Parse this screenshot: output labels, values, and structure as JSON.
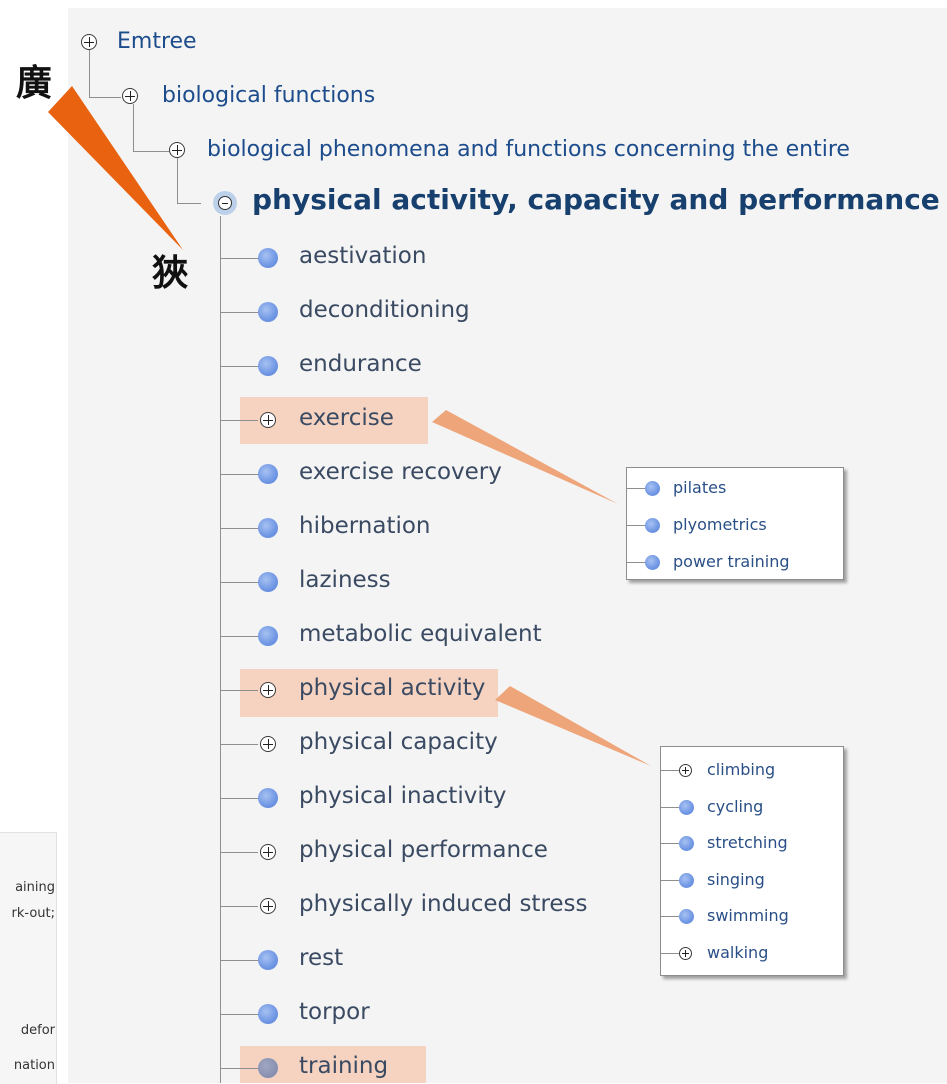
{
  "tree": {
    "root": "Emtree",
    "level1": "biological functions",
    "level2": "biological phenomena and functions concerning the entire",
    "current": "physical activity, capacity and performance",
    "children": [
      {
        "label": "aestivation",
        "type": "leaf"
      },
      {
        "label": "deconditioning",
        "type": "leaf"
      },
      {
        "label": "endurance",
        "type": "leaf"
      },
      {
        "label": "exercise",
        "type": "expand",
        "highlight": true
      },
      {
        "label": "exercise recovery",
        "type": "leaf"
      },
      {
        "label": "hibernation",
        "type": "leaf"
      },
      {
        "label": "laziness",
        "type": "leaf"
      },
      {
        "label": "metabolic equivalent",
        "type": "leaf"
      },
      {
        "label": "physical activity",
        "type": "expand",
        "highlight": true
      },
      {
        "label": "physical capacity",
        "type": "expand"
      },
      {
        "label": "physical inactivity",
        "type": "leaf"
      },
      {
        "label": "physical performance",
        "type": "expand"
      },
      {
        "label": "physically induced stress",
        "type": "expand"
      },
      {
        "label": "rest",
        "type": "leaf"
      },
      {
        "label": "torpor",
        "type": "leaf"
      },
      {
        "label": "training",
        "type": "leaf",
        "highlight": true,
        "selected": true
      }
    ]
  },
  "popups": {
    "exercise": [
      {
        "label": "pilates",
        "type": "leaf"
      },
      {
        "label": "plyometrics",
        "type": "leaf"
      },
      {
        "label": "power training",
        "type": "leaf"
      }
    ],
    "physical_activity": [
      {
        "label": "climbing",
        "type": "expand"
      },
      {
        "label": "cycling",
        "type": "leaf"
      },
      {
        "label": "stretching",
        "type": "leaf"
      },
      {
        "label": "singing",
        "type": "leaf"
      },
      {
        "label": "swimming",
        "type": "leaf"
      },
      {
        "label": "walking",
        "type": "expand"
      }
    ]
  },
  "annotations": {
    "broad": "廣",
    "narrow": "狹"
  },
  "side_panel": {
    "lines": [
      "aining",
      "rk-out;",
      "defor",
      "nation"
    ]
  },
  "colors": {
    "highlight": "#f5d3c0",
    "callout_arrow": "#eea57a",
    "main_arrow": "#e8620f",
    "link_blue": "#1c4c8c",
    "leaf_blue": "#6f96e4"
  },
  "icons": {
    "expand": "plus-circle-icon",
    "collapse": "minus-circle-icon",
    "leaf": "blue-dot-icon"
  }
}
